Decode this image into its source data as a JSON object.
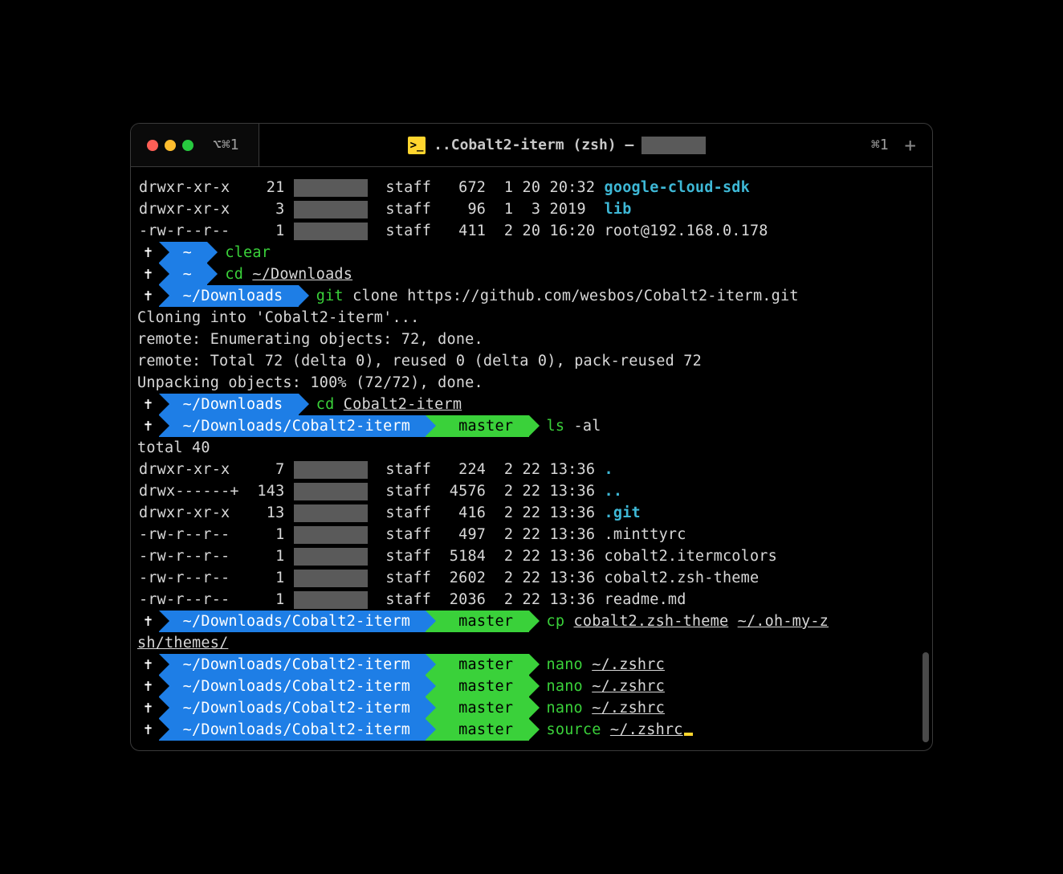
{
  "titlebar": {
    "left_tab": "⌥⌘1",
    "title_prefix": "..Cobalt2-iterm (zsh) —",
    "right_shortcut": "⌘1"
  },
  "ls_top": [
    {
      "perm": "drwxr-xr-x",
      "n": "21",
      "grp": "staff",
      "size": "672",
      "m": "1",
      "d": "20",
      "t": "20:32",
      "name": "google-cloud-sdk",
      "cls": "cyan"
    },
    {
      "perm": "drwxr-xr-x",
      "n": "3",
      "grp": "staff",
      "size": "96",
      "m": "1",
      "d": "3",
      "t": "2019",
      "name": "lib",
      "cls": "cyan"
    },
    {
      "perm": "-rw-r--r--",
      "n": "1",
      "grp": "staff",
      "size": "411",
      "m": "2",
      "d": "20",
      "t": "16:20",
      "name": "root@192.168.0.178",
      "cls": ""
    }
  ],
  "p1": {
    "path": "~",
    "cmd": "clear"
  },
  "p2": {
    "path": "~",
    "cmd": "cd ",
    "arg": "~/Downloads"
  },
  "p3": {
    "path": "~/Downloads",
    "cmd": "git",
    "rest": " clone https://github.com/wesbos/Cobalt2-iterm.git"
  },
  "clone_out": [
    "Cloning into 'Cobalt2-iterm'...",
    "remote: Enumerating objects: 72, done.",
    "remote: Total 72 (delta 0), reused 0 (delta 0), pack-reused 72",
    "Unpacking objects: 100% (72/72), done."
  ],
  "p4": {
    "path": "~/Downloads",
    "cmd": "cd ",
    "arg": "Cobalt2-iterm"
  },
  "p5": {
    "path": "~/Downloads/Cobalt2-iterm",
    "branch": "master",
    "cmd": "ls",
    "rest": " -al"
  },
  "total": "total 40",
  "ls_repo": [
    {
      "perm": "drwxr-xr-x",
      "n": "7",
      "grp": "staff",
      "size": "224",
      "m": "2",
      "d": "22",
      "t": "13:36",
      "name": ".",
      "cls": "cyan"
    },
    {
      "perm": "drwx------+",
      "n": "143",
      "grp": "staff",
      "size": "4576",
      "m": "2",
      "d": "22",
      "t": "13:36",
      "name": "..",
      "cls": "cyan"
    },
    {
      "perm": "drwxr-xr-x",
      "n": "13",
      "grp": "staff",
      "size": "416",
      "m": "2",
      "d": "22",
      "t": "13:36",
      "name": ".git",
      "cls": "cyan"
    },
    {
      "perm": "-rw-r--r--",
      "n": "1",
      "grp": "staff",
      "size": "497",
      "m": "2",
      "d": "22",
      "t": "13:36",
      "name": ".minttyrc",
      "cls": ""
    },
    {
      "perm": "-rw-r--r--",
      "n": "1",
      "grp": "staff",
      "size": "5184",
      "m": "2",
      "d": "22",
      "t": "13:36",
      "name": "cobalt2.itermcolors",
      "cls": ""
    },
    {
      "perm": "-rw-r--r--",
      "n": "1",
      "grp": "staff",
      "size": "2602",
      "m": "2",
      "d": "22",
      "t": "13:36",
      "name": "cobalt2.zsh-theme",
      "cls": ""
    },
    {
      "perm": "-rw-r--r--",
      "n": "1",
      "grp": "staff",
      "size": "2036",
      "m": "2",
      "d": "22",
      "t": "13:36",
      "name": "readme.md",
      "cls": ""
    }
  ],
  "p6": {
    "path": "~/Downloads/Cobalt2-iterm",
    "branch": "master",
    "cmd": "cp ",
    "arg1": "cobalt2.zsh-theme",
    "arg2": "~/.oh-my-z"
  },
  "p6_wrap": "sh/themes/",
  "p7": {
    "path": "~/Downloads/Cobalt2-iterm",
    "branch": "master",
    "cmd": "nano ",
    "arg": "~/.zshrc"
  },
  "p8": {
    "path": "~/Downloads/Cobalt2-iterm",
    "branch": "master",
    "cmd": "nano ",
    "arg": "~/.zshrc"
  },
  "p9": {
    "path": "~/Downloads/Cobalt2-iterm",
    "branch": "master",
    "cmd": "nano ",
    "arg": "~/.zshrc"
  },
  "p10": {
    "path": "~/Downloads/Cobalt2-iterm",
    "branch": "master",
    "cmd": "source ",
    "arg": "~/.zshrc"
  }
}
